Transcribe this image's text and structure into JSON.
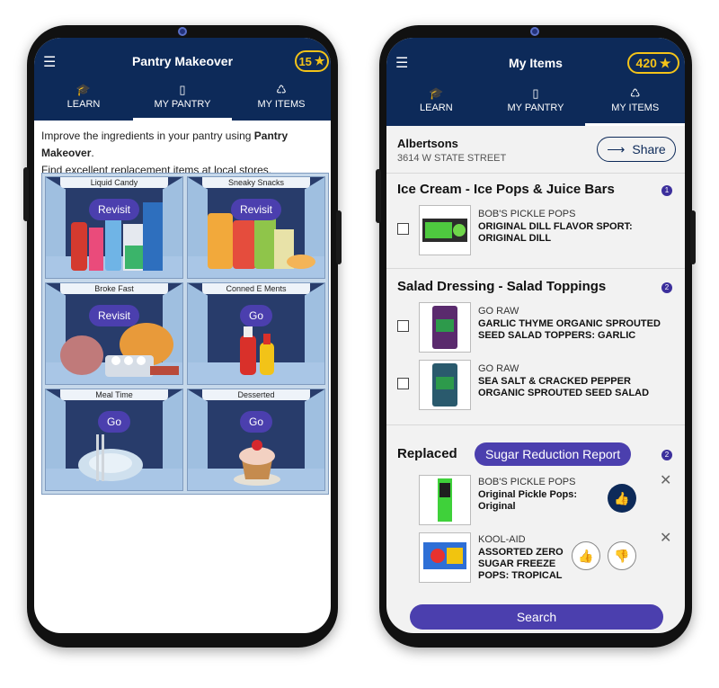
{
  "left_screen": {
    "title": "Pantry Makeover",
    "coins": "15",
    "tabs": [
      {
        "label": "LEARN",
        "icon": "graduation-cap-icon"
      },
      {
        "label": "MY PANTRY",
        "icon": "pantry-icon",
        "active": true
      },
      {
        "label": "MY ITEMS",
        "icon": "basket-icon"
      }
    ],
    "intro_text_1": "Improve the ingredients in your pantry using ",
    "intro_bold": "Pantry Makeover",
    "intro_text_2": ".",
    "intro_line2": "Find excellent replacement items at local stores.",
    "shelves": [
      {
        "label": "Liquid Candy",
        "action": "Revisit"
      },
      {
        "label": "Sneaky Snacks",
        "action": "Revisit"
      },
      {
        "label": "Broke Fast",
        "action": "Revisit"
      },
      {
        "label": "Conned E Ments",
        "action": "Go"
      },
      {
        "label": "Meal Time",
        "action": "Go"
      },
      {
        "label": "Desserted",
        "action": "Go"
      }
    ]
  },
  "right_screen": {
    "title": "My Items",
    "coins": "420",
    "tabs": [
      {
        "label": "LEARN",
        "icon": "graduation-cap-icon"
      },
      {
        "label": "MY PANTRY",
        "icon": "pantry-icon"
      },
      {
        "label": "MY ITEMS",
        "icon": "basket-icon",
        "active": true
      }
    ],
    "store": {
      "name": "Albertsons",
      "address": "3614 W STATE STREET"
    },
    "share_label": "Share",
    "sections": [
      {
        "title": "Ice Cream - Ice Pops & Juice Bars",
        "count": "1",
        "items": [
          {
            "brand": "BOB'S PICKLE POPS",
            "name": "ORIGINAL DILL FLAVOR SPORT: ORIGINAL DILL"
          }
        ]
      },
      {
        "title": "Salad Dressing - Salad Toppings",
        "count": "2",
        "items": [
          {
            "brand": "GO RAW",
            "name": "GARLIC THYME ORGANIC SPROUTED SEED SALAD TOPPERS: GARLIC"
          },
          {
            "brand": "GO RAW",
            "name": "SEA SALT & CRACKED PEPPER ORGANIC SPROUTED SEED SALAD"
          }
        ]
      }
    ],
    "replaced": {
      "title": "Replaced",
      "report_label": "Sugar Reduction Report",
      "count": "2",
      "items": [
        {
          "brand": "BOB'S PICKLE POPS",
          "name": "Original Pickle Pops: Original"
        },
        {
          "brand": "KOOL-AID",
          "name": "ASSORTED ZERO SUGAR FREEZE POPS: TROPICAL"
        }
      ]
    },
    "search_label": "Search"
  },
  "colors": {
    "navy": "#0d2a59",
    "purple": "#4b3fae",
    "gold": "#f3c319"
  }
}
